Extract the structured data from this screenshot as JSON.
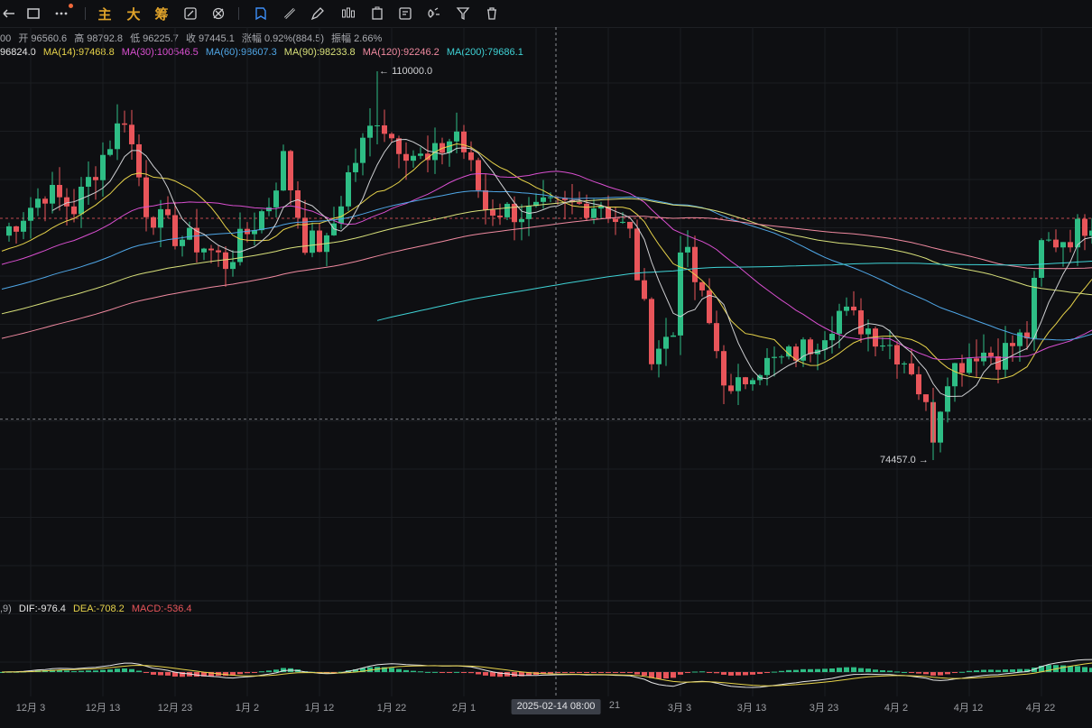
{
  "toolbar": {
    "back_icon": "back-arrow-icon",
    "rect_icon": "rectangle-icon",
    "more_icon": "more-dots-icon",
    "main_label": "主",
    "big_label": "大",
    "chips_label": "筹",
    "tools": [
      "indicator-edit-icon",
      "brush-off-icon",
      "bookmark-icon",
      "ruler-icon",
      "pen-icon",
      "pattern-icon",
      "text-note-icon",
      "note-icon",
      "magnet-icon",
      "filter-icon",
      "trash-icon"
    ],
    "notification_color": "#f0683a",
    "accent": "#e0a32a",
    "active_color": "#3d8ef7"
  },
  "ohlc": {
    "prefix": "00",
    "open_label": "开",
    "open": "96560.6",
    "high_label": "高",
    "high": "98792.8",
    "low_label": "低",
    "low": "96225.7",
    "close_label": "收",
    "close": "97445.1",
    "change_label": "涨幅",
    "change": "0.92%(884.5)",
    "amplitude_label": "振幅",
    "amplitude": "2.66%"
  },
  "ma_row": [
    {
      "text": "96824.0",
      "color": "#e8e8e8"
    },
    {
      "text": "MA(14):97468.8",
      "color": "#e7d34a"
    },
    {
      "text": "MA(30):100546.5",
      "color": "#d94fd0"
    },
    {
      "text": "MA(60):98607.3",
      "color": "#4fa6e6"
    },
    {
      "text": "MA(90):98233.8",
      "color": "#d8e07a"
    },
    {
      "text": "MA(120):92246.2",
      "color": "#f08aa0"
    },
    {
      "text": "MA(200):79686.1",
      "color": "#3fd3d6"
    }
  ],
  "macd_row": {
    "prefix": ",9)",
    "dif": "DIF:-976.4",
    "dea": "DEA:-708.2",
    "macd": "MACD:-536.4",
    "dif_color": "#e6e6e6",
    "dea_color": "#e7d34a",
    "macd_color": "#e8555a"
  },
  "annotations": {
    "high": "110000.0",
    "low": "74457.0"
  },
  "xaxis": {
    "ticks": [
      "12月 3",
      "12月 13",
      "12月 23",
      "1月 2",
      "1月 12",
      "1月 22",
      "2月 1",
      "21",
      "3月 3",
      "3月 13",
      "3月 23",
      "4月 2",
      "4月 12",
      "4月 22"
    ],
    "cursor_label": "2025-02-14 08:00"
  },
  "colors": {
    "up": "#2ebd85",
    "down": "#e8555a",
    "background": "#0e0f12",
    "grid": "#1b1d21"
  },
  "chart_data": {
    "type": "candlestick",
    "title": "",
    "xlabel": "",
    "ylabel": "",
    "ylim": [
      70000,
      112000
    ],
    "grid": true,
    "interval": "1 day",
    "current_bar": {
      "open": 96560.6,
      "high": 98792.8,
      "low": 96225.7,
      "close": 97445.1
    },
    "marked_high": 110000.0,
    "marked_low": 74457.0,
    "reference_lines": [
      96560,
      78200
    ],
    "price_anchors": [
      {
        "date": "11-29",
        "price": 95000
      },
      {
        "date": "12-05",
        "price": 99000
      },
      {
        "date": "12-09",
        "price": 97500
      },
      {
        "date": "12-16",
        "price": 106000
      },
      {
        "date": "12-19",
        "price": 97500
      },
      {
        "date": "12-23",
        "price": 95000
      },
      {
        "date": "12-27",
        "price": 94000
      },
      {
        "date": "12-30",
        "price": 92500
      },
      {
        "date": "01-05",
        "price": 98000
      },
      {
        "date": "01-07",
        "price": 102000
      },
      {
        "date": "01-10",
        "price": 94500
      },
      {
        "date": "01-13",
        "price": 94000
      },
      {
        "date": "01-16",
        "price": 100500
      },
      {
        "date": "01-20",
        "price": 106000
      },
      {
        "date": "01-22",
        "price": 104000
      },
      {
        "date": "01-27",
        "price": 101500
      },
      {
        "date": "01-31",
        "price": 104500
      },
      {
        "date": "02-04",
        "price": 97500
      },
      {
        "date": "02-10",
        "price": 97000
      },
      {
        "date": "02-14",
        "price": 97500
      },
      {
        "date": "02-20",
        "price": 98000
      },
      {
        "date": "02-24",
        "price": 95000
      },
      {
        "date": "02-27",
        "price": 84500
      },
      {
        "date": "03-02",
        "price": 86000
      },
      {
        "date": "03-03",
        "price": 94500
      },
      {
        "date": "03-06",
        "price": 89000
      },
      {
        "date": "03-10",
        "price": 80000
      },
      {
        "date": "03-13",
        "price": 83000
      },
      {
        "date": "03-17",
        "price": 83500
      },
      {
        "date": "03-21",
        "price": 85000
      },
      {
        "date": "03-25",
        "price": 88000
      },
      {
        "date": "03-29",
        "price": 86500
      },
      {
        "date": "04-01",
        "price": 85000
      },
      {
        "date": "04-04",
        "price": 83000
      },
      {
        "date": "04-07",
        "price": 77000
      },
      {
        "date": "04-09",
        "price": 82500
      },
      {
        "date": "04-13",
        "price": 84500
      },
      {
        "date": "04-16",
        "price": 84000
      },
      {
        "date": "04-20",
        "price": 86000
      },
      {
        "date": "04-22",
        "price": 94000
      },
      {
        "date": "04-26",
        "price": 95000
      },
      {
        "date": "04-29",
        "price": 96560
      }
    ],
    "moving_averages": [
      {
        "name": "MA(14)",
        "value": 97468.8
      },
      {
        "name": "MA(30)",
        "value": 100546.5
      },
      {
        "name": "MA(60)",
        "value": 98607.3
      },
      {
        "name": "MA(90)",
        "value": 98233.8
      },
      {
        "name": "MA(120)",
        "value": 92246.2
      },
      {
        "name": "MA(200)",
        "value": 79686.1
      }
    ],
    "macd": {
      "dif": -976.4,
      "dea": -708.2,
      "histogram": -536.4
    }
  }
}
